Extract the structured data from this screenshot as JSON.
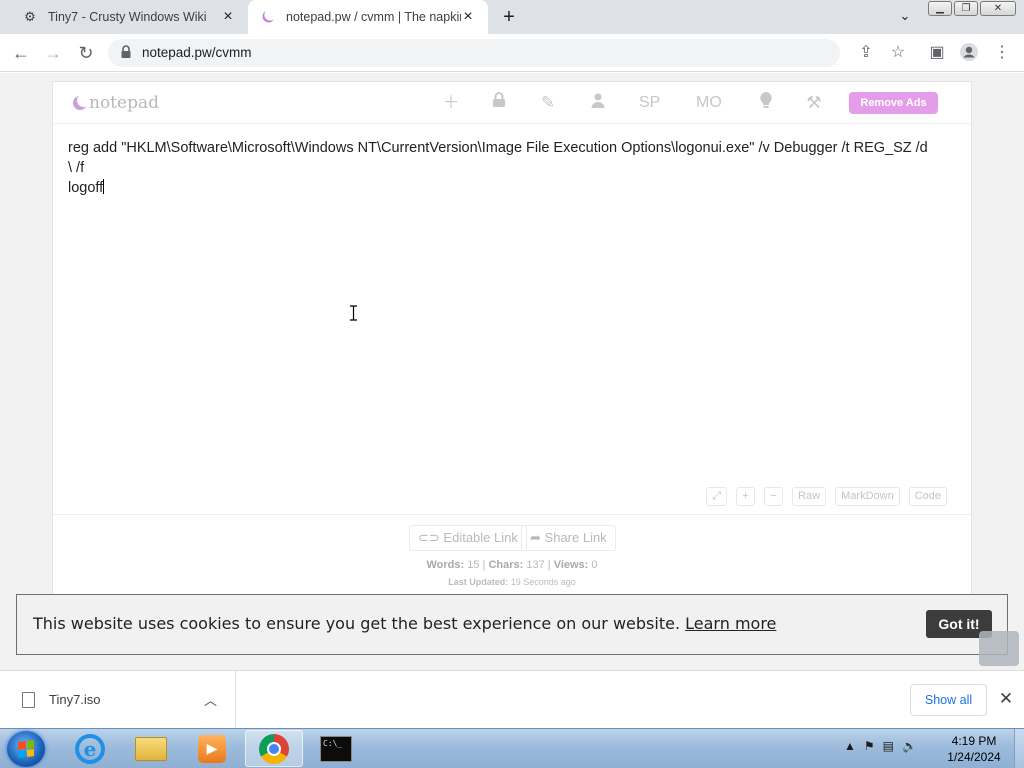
{
  "browser": {
    "tabs": [
      {
        "title": "Tiny7 - Crusty Windows Wiki",
        "favicon": "puzzle-icon"
      },
      {
        "title": "notepad.pw / cvmm | The napkin",
        "favicon": "notepad-moon-icon"
      }
    ],
    "url": "notepad.pw/cvmm"
  },
  "notepad": {
    "logo": "notepad",
    "nav_sp": "SP",
    "nav_mo": "MO",
    "remove_ads": "Remove Ads",
    "content_line1": "reg add \"HKLM\\Software\\Microsoft\\Windows NT\\CurrentVersion\\Image File Execution Options\\logonui.exe\" /v Debugger /t REG_SZ /d",
    "content_line2": "\\ /f",
    "content_line3": "logoff",
    "format_buttons": {
      "expand": "⤢",
      "plus": "+",
      "minus": "−",
      "raw": "Raw",
      "markdown": "MarkDown",
      "code": "Code"
    },
    "editable_link": "Editable Link",
    "share_link": "Share Link",
    "stats": {
      "words_label": "Words:",
      "words": "15",
      "chars_label": "Chars:",
      "chars": "137",
      "views_label": "Views:",
      "views": "0"
    },
    "updated_label": "Last Updated:",
    "updated_value": "19 Seconds ago"
  },
  "cookie": {
    "text": "This website uses cookies to ensure you get the best experience on our website.",
    "learn_more": "Learn more",
    "button": "Got it!"
  },
  "downloads": {
    "file": "Tiny7.iso",
    "show_all": "Show all"
  },
  "taskbar": {
    "time": "4:19 PM",
    "date": "1/24/2024"
  },
  "colors": {
    "accent_pink": "#e39de9",
    "chrome_blue": "#1a73e8",
    "cookie_button": "#3c3c3c"
  }
}
